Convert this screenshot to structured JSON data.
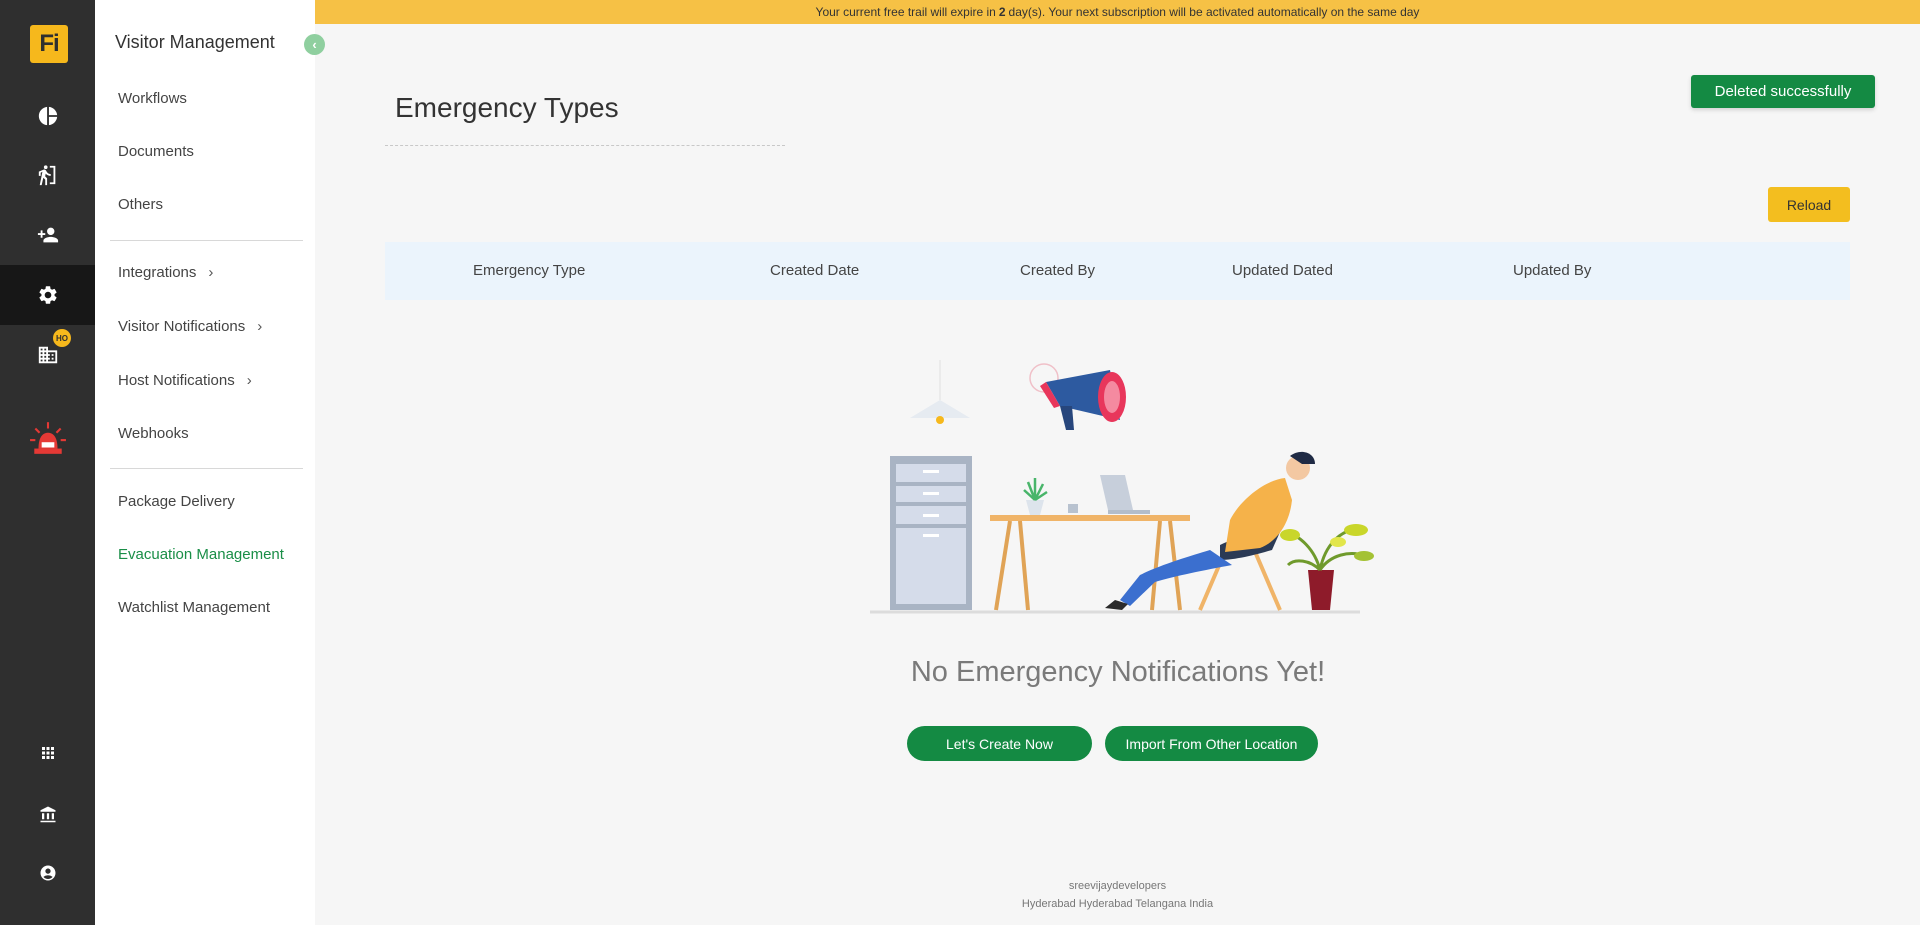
{
  "app": {
    "logo_text": "Fi"
  },
  "banner": {
    "text_before": "Your current free trail will expire in",
    "days": "2",
    "text_after": "day(s). Your next subscription will be activated automatically on the same day"
  },
  "rail": {
    "items": [
      {
        "icon": "dashboard-pie-icon"
      },
      {
        "icon": "visitor-walk-icon"
      },
      {
        "icon": "add-user-icon"
      },
      {
        "icon": "settings-gear-icon",
        "active": true
      },
      {
        "icon": "building-icon",
        "badge": "HO"
      },
      {
        "icon": "emergency-siren-icon"
      }
    ],
    "bottom_items": [
      {
        "icon": "apps-grid-icon"
      },
      {
        "icon": "bank-icon"
      },
      {
        "icon": "account-icon"
      }
    ]
  },
  "sidebar": {
    "title": "Visitor Management",
    "group1": [
      "Workflows",
      "Documents",
      "Others"
    ],
    "group2": [
      {
        "label": "Integrations",
        "expandable": true
      },
      {
        "label": "Visitor Notifications",
        "expandable": true
      },
      {
        "label": "Host Notifications",
        "expandable": true
      },
      {
        "label": "Webhooks",
        "expandable": false
      }
    ],
    "group3": [
      {
        "label": "Package Delivery",
        "active": false
      },
      {
        "label": "Evacuation Management",
        "active": true
      },
      {
        "label": "Watchlist Management",
        "active": false
      }
    ]
  },
  "main": {
    "title": "Emergency Types",
    "toast": "Deleted successfully",
    "reload_label": "Reload",
    "columns": [
      "Emergency Type",
      "Created Date",
      "Created By",
      "Updated Dated",
      "Updated By"
    ],
    "empty_title": "No Emergency Notifications Yet!",
    "create_label": "Let's Create Now",
    "import_label": "Import From Other Location"
  },
  "footer": {
    "company": "sreevijaydevelopers",
    "address": "Hyderabad Hyderabad Telangana India"
  },
  "colors": {
    "rail_bg": "#2f2f2f",
    "banner": "#f6c145",
    "primary_green": "#148a43",
    "reload_yellow": "#f3be1f",
    "header_blue": "#ebf4fc"
  }
}
